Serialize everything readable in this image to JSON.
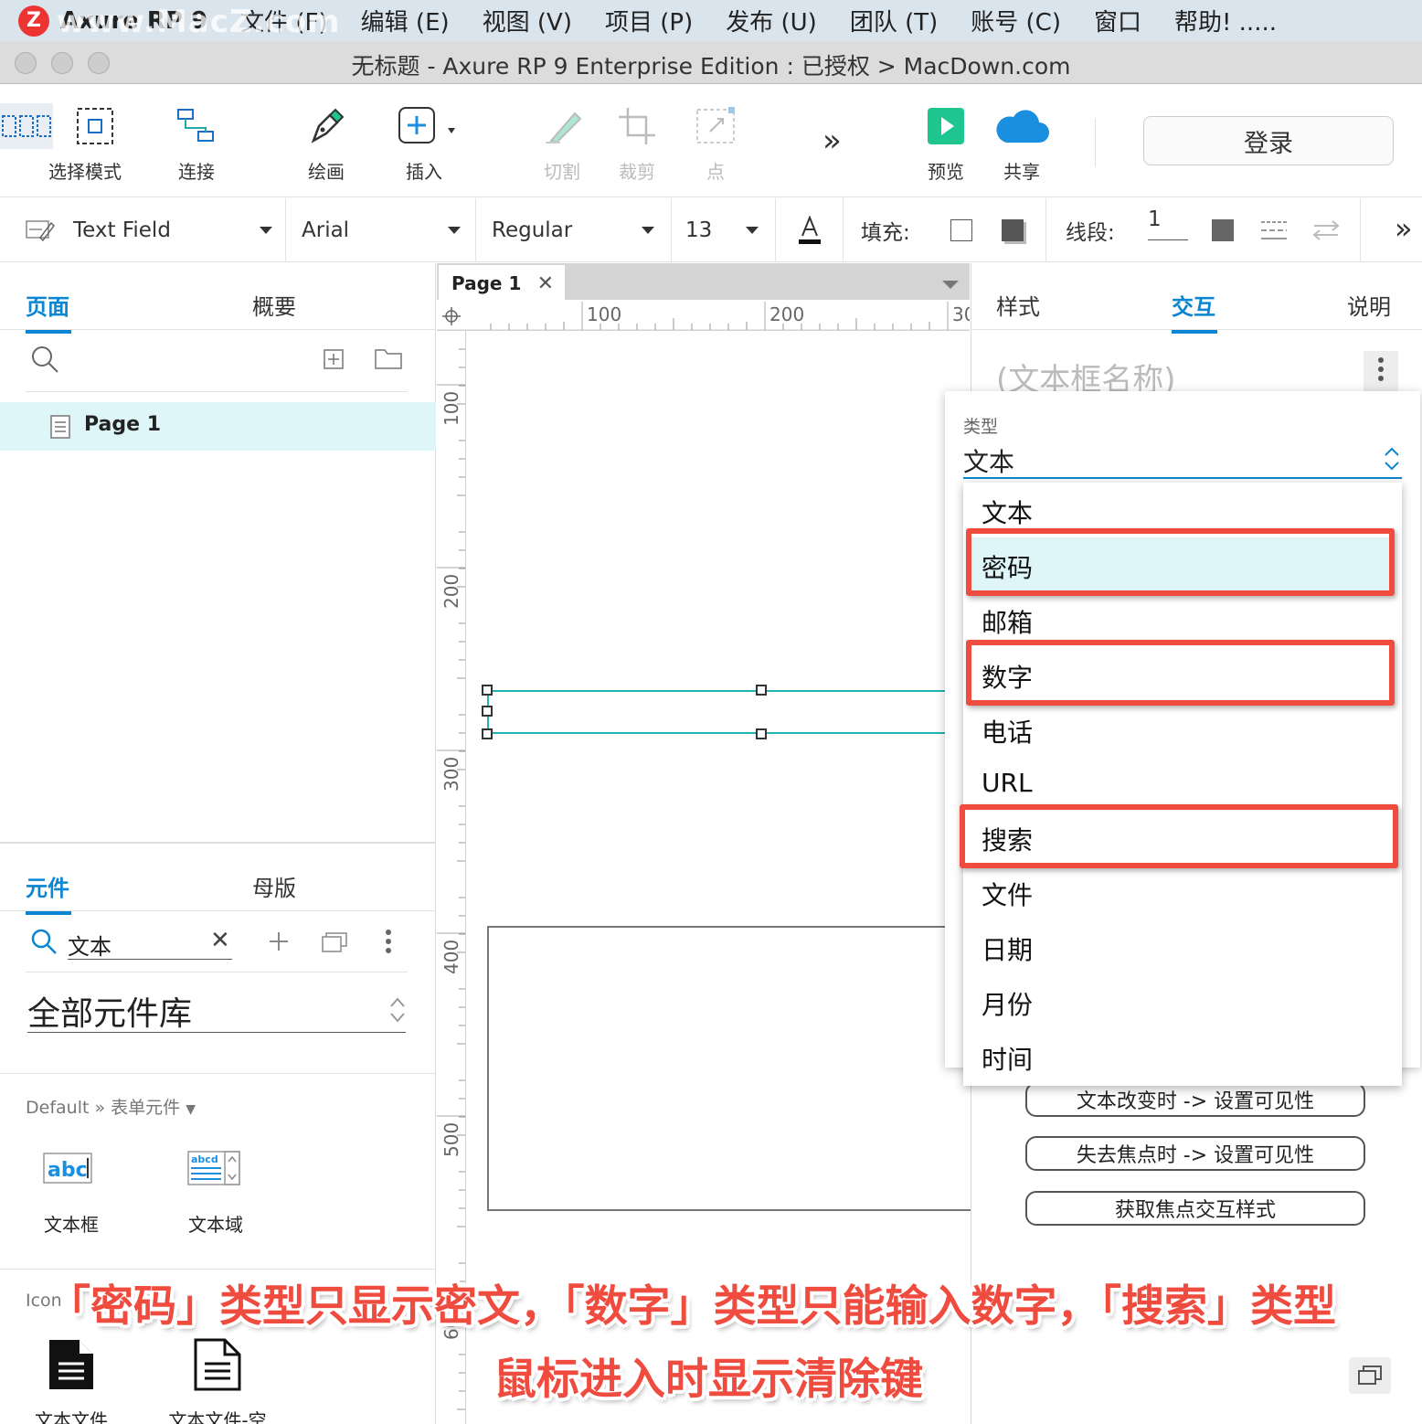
{
  "menubar": {
    "logo": "Z",
    "app": "Axure RP 9",
    "watermark": "www.MacZ.com",
    "items": [
      "文件 (F)",
      "编辑 (E)",
      "视图 (V)",
      "项目 (P)",
      "发布 (U)",
      "团队 (T)",
      "账号 (C)",
      "窗口",
      "帮助!  ....."
    ]
  },
  "window": {
    "title": "无标题 - Axure RP 9 Enterprise Edition : 已授权 > MacDown.com"
  },
  "toolbar": {
    "select_mode": "选择模式",
    "connect": "连接",
    "draw": "绘画",
    "insert": "插入",
    "cut": "切割",
    "crop": "裁剪",
    "point": "点",
    "more": "»",
    "preview": "预览",
    "share": "共享",
    "login": "登录"
  },
  "format": {
    "widget_type": "Text Field",
    "font": "Arial",
    "weight": "Regular",
    "size": "13",
    "fill_label": "填充:",
    "stroke_label": "线段:",
    "stroke_value": "1",
    "more": "»"
  },
  "left_panel": {
    "tabs": {
      "pages": "页面",
      "outline": "概要"
    },
    "pages": [
      {
        "name": "Page 1"
      }
    ],
    "widget_tabs": {
      "widgets": "元件",
      "masters": "母版"
    },
    "search_value": "文本",
    "library": "全部元件库",
    "breadcrumb": "Default » 表单元件",
    "widgets": [
      {
        "label": "文本框"
      },
      {
        "label": "文本域"
      }
    ],
    "section_partial": "Icon",
    "files": [
      {
        "label": "文本文件"
      },
      {
        "label": "文本文件-空"
      }
    ]
  },
  "canvas": {
    "page_tab": "Page 1",
    "ruler_top": [
      "100",
      "200",
      "30"
    ],
    "ruler_left": [
      "100",
      "200",
      "300",
      "400",
      "500",
      "60"
    ]
  },
  "right_panel": {
    "tabs": {
      "style": "样式",
      "interaction": "交互",
      "notes": "说明"
    },
    "name_placeholder": "(文本框名称)",
    "type_label": "类型",
    "type_value": "文本",
    "options": [
      "文本",
      "密码",
      "邮箱",
      "数字",
      "电话",
      "URL",
      "搜索",
      "文件",
      "日期",
      "月份",
      "时间"
    ],
    "highlighted": [
      "密码",
      "数字",
      "搜索"
    ],
    "interaction_buttons": [
      "文本改变时 -> 设置可见性",
      "失去焦点时 -> 设置可见性",
      "获取焦点交互样式"
    ]
  },
  "caption": {
    "line1": "「密码」类型只显示密文，「数字」类型只能输入数字，「搜索」类型",
    "line2": "鼠标进入时显示清除键"
  },
  "colors": {
    "accent": "#0a85d1",
    "highlight": "#ef4b3f",
    "selection": "#22b3b3",
    "page_selected": "#dff6f8",
    "option_hover": "#dff6f8",
    "menubar": "#d9e4ec",
    "preview_green": "#1ec58f",
    "cloud_blue": "#1a8fe0"
  }
}
